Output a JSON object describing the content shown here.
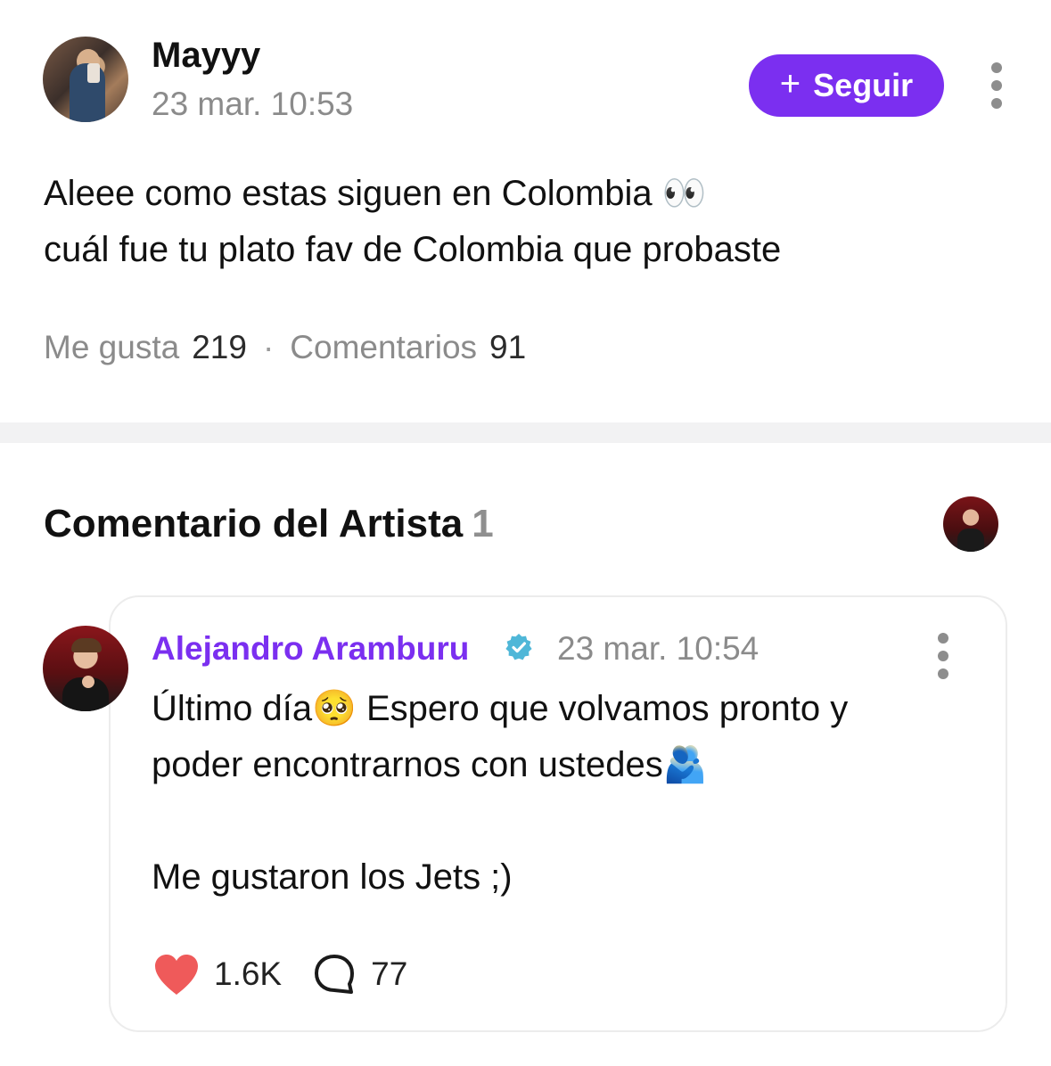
{
  "post": {
    "author": "Mayyy",
    "timestamp": "23 mar. 10:53",
    "follow_label": "Seguir",
    "follow_plus": "+",
    "text": "Aleee como estas siguen en Colombia 👀\ncuál fue tu plato fav de Colombia que probaste",
    "likes_label": "Me gusta",
    "likes_count": "219",
    "separator": "·",
    "comments_label": "Comentarios",
    "comments_count": "91"
  },
  "artist_section": {
    "title": "Comentario del Artista",
    "count": "1"
  },
  "artist_comment": {
    "author": "Alejandro Aramburu",
    "timestamp": "23 mar. 10:54",
    "text": "Último día🥺 Espero que volvamos pronto y\npoder encontrarnos con ustedes🫂\n\nMe gustaron los Jets ;)",
    "likes": "1.6K",
    "replies": "77"
  },
  "colors": {
    "accent": "#7b2ff0",
    "heart": "#ef5a5a",
    "verified": "#4fb7d8",
    "muted_text": "#8b8b8b",
    "divider": "#f2f2f3"
  },
  "icons": {
    "options": "more-vertical-icon",
    "follow": "plus-icon",
    "verified": "verified-badge-icon",
    "like": "heart-icon",
    "reply": "speech-bubble-icon"
  }
}
